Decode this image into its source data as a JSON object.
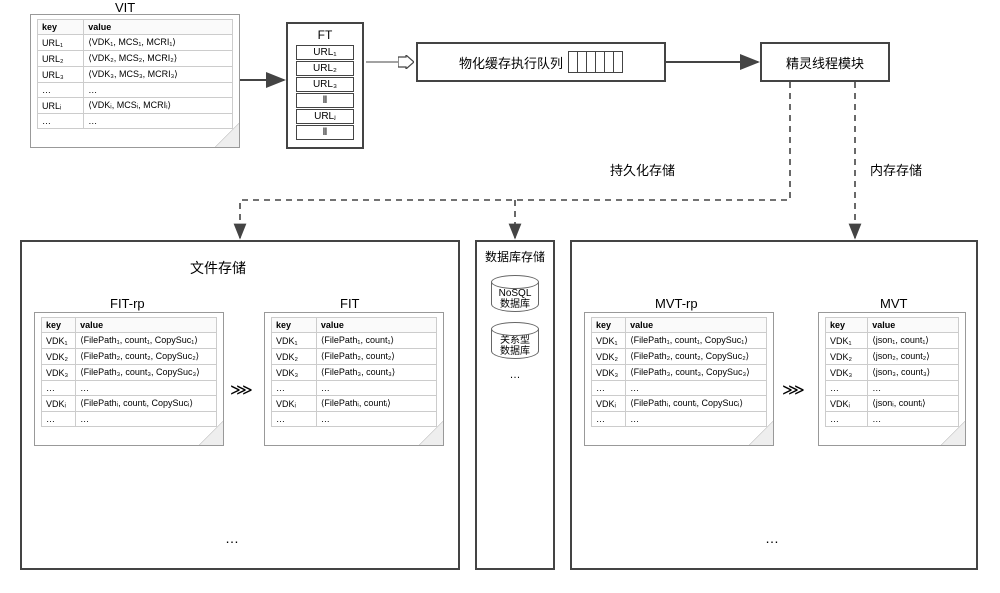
{
  "top": {
    "vit": {
      "title": "VIT",
      "headers": [
        "key",
        "value"
      ],
      "rows": [
        [
          "URL₁",
          "⟨VDK₁, MCS₁, MCRI₁⟩"
        ],
        [
          "URL₂",
          "⟨VDK₂, MCS₂, MCRI₂⟩"
        ],
        [
          "URL₃",
          "⟨VDK₃, MCS₃, MCRI₃⟩"
        ],
        [
          "…",
          "…"
        ],
        [
          "URLᵢ",
          "⟨VDKᵢ, MCSᵢ, MCRIᵢ⟩"
        ],
        [
          "…",
          "…"
        ]
      ]
    },
    "ft": {
      "title": "FT",
      "items": [
        "URL₁",
        "URL₂",
        "URL₃",
        "Ⅱ",
        "URLⱼ",
        "Ⅱ"
      ]
    },
    "queue": {
      "label": "物化缓存执行队列"
    },
    "sprite": {
      "label": "精灵线程模块"
    },
    "edges": {
      "persist_label": "持久化存储",
      "mem_label": "内存存储"
    }
  },
  "bottom": {
    "file_storage": {
      "title": "文件存储",
      "fit_rp": {
        "title": "FIT-rp",
        "headers": [
          "key",
          "value"
        ],
        "rows": [
          [
            "VDK₁",
            "⟨FilePath₁, count₁, CopySuc₁⟩"
          ],
          [
            "VDK₂",
            "⟨FilePath₂, count₂, CopySuc₂⟩"
          ],
          [
            "VDK₃",
            "⟨FilePath₃, count₃, CopySuc₃⟩"
          ],
          [
            "…",
            "…"
          ],
          [
            "VDKᵢ",
            "⟨FilePathᵢ, countᵢ, CopySucᵢ⟩"
          ],
          [
            "…",
            "…"
          ]
        ]
      },
      "fit": {
        "title": "FIT",
        "headers": [
          "key",
          "value"
        ],
        "rows": [
          [
            "VDK₁",
            "⟨FilePath₁, count₁⟩"
          ],
          [
            "VDK₂",
            "⟨FilePath₂, count₂⟩"
          ],
          [
            "VDK₃",
            "⟨FilePath₃, count₃⟩"
          ],
          [
            "…",
            "…"
          ],
          [
            "VDKᵢ",
            "⟨FilePathᵢ, countᵢ⟩"
          ],
          [
            "…",
            "…"
          ]
        ]
      },
      "dots": "…"
    },
    "db_storage": {
      "title": "数据库存储",
      "nosql": "NoSQL\n数据库",
      "rel": "关系型\n数据库",
      "dots": "…"
    },
    "mem_storage": {
      "mvt_rp": {
        "title": "MVT-rp",
        "headers": [
          "key",
          "value"
        ],
        "rows": [
          [
            "VDK₁",
            "⟨FilePath₁, count₁, CopySuc₁⟩"
          ],
          [
            "VDK₂",
            "⟨FilePath₂, count₂, CopySuc₂⟩"
          ],
          [
            "VDK₃",
            "⟨FilePath₃, count₃, CopySuc₃⟩"
          ],
          [
            "…",
            "…"
          ],
          [
            "VDKᵢ",
            "⟨FilePathᵢ, countᵢ, CopySucᵢ⟩"
          ],
          [
            "…",
            "…"
          ]
        ]
      },
      "mvt": {
        "title": "MVT",
        "headers": [
          "key",
          "value"
        ],
        "rows": [
          [
            "VDK₁",
            "⟨json₁, count₁⟩"
          ],
          [
            "VDK₂",
            "⟨json₂, count₂⟩"
          ],
          [
            "VDK₃",
            "⟨json₃, count₃⟩"
          ],
          [
            "…",
            "…"
          ],
          [
            "VDKᵢ",
            "⟨jsonᵢ, countᵢ⟩"
          ],
          [
            "…",
            "…"
          ]
        ]
      },
      "dots": "…"
    }
  },
  "transform_sym": "⋙"
}
